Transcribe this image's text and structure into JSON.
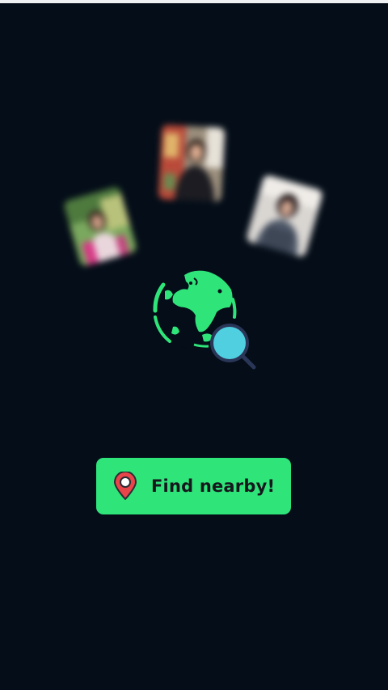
{
  "colors": {
    "background": "#040d18",
    "accent_green": "#2fe57a",
    "magnifier_lens": "#4fcfe0",
    "magnifier_rim": "#2a3658",
    "pin_red": "#e8454b",
    "button_text": "#14171c"
  },
  "icons": {
    "globe": "globe-icon",
    "magnifier": "search-icon",
    "pin": "location-pin-icon"
  },
  "cards": [
    {
      "name": "nearby-user-photo-1"
    },
    {
      "name": "nearby-user-photo-2"
    },
    {
      "name": "nearby-user-photo-3"
    }
  ],
  "action": {
    "find_nearby_label": "Find nearby!"
  }
}
